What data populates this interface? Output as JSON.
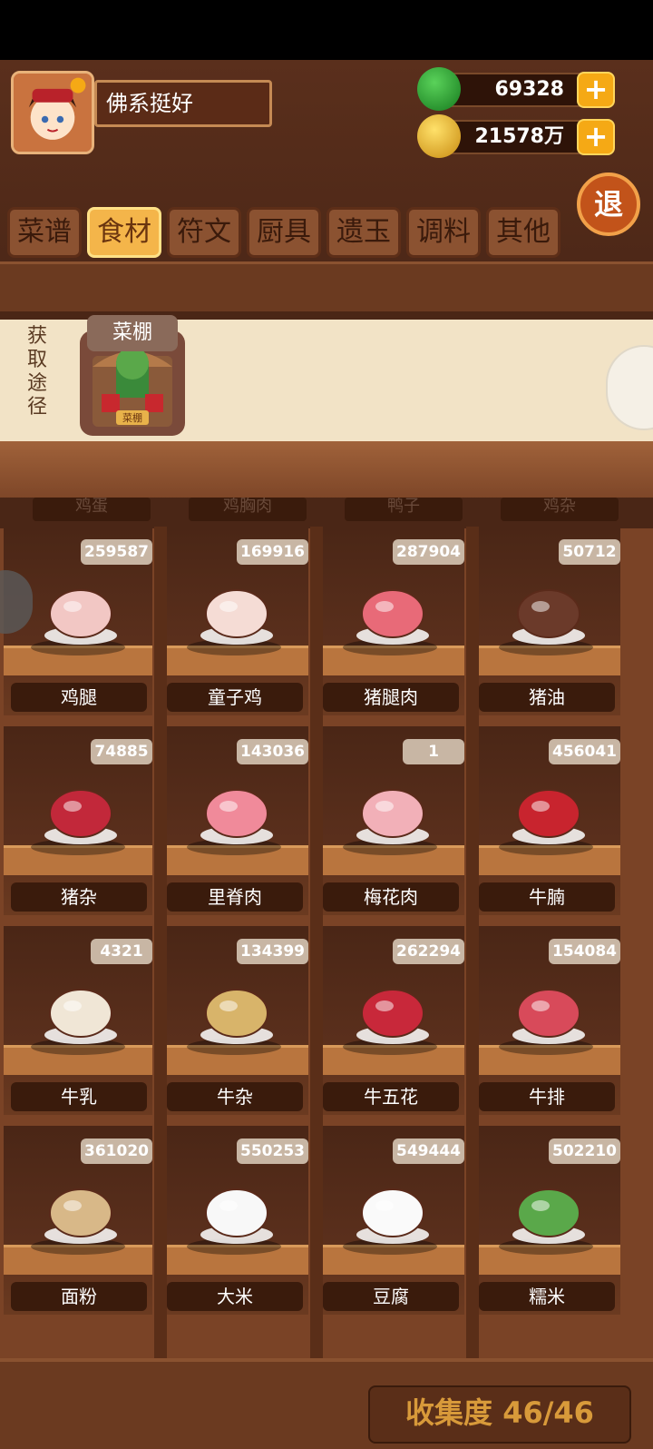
{
  "player": {
    "name": "佛系挺好"
  },
  "resources": [
    {
      "name": "jade",
      "value": "69328",
      "color": "#1f8a2a"
    },
    {
      "name": "coin",
      "value": "21578万",
      "color": "#e0a818"
    }
  ],
  "exit_label": "退",
  "tabs": [
    {
      "label": "菜谱",
      "active": false
    },
    {
      "label": "食材",
      "active": true
    },
    {
      "label": "符文",
      "active": false
    },
    {
      "label": "厨具",
      "active": false
    },
    {
      "label": "遗玉",
      "active": false
    },
    {
      "label": "调料",
      "active": false
    },
    {
      "label": "其他",
      "active": false
    }
  ],
  "source": {
    "title": "获取途径",
    "card_label": "菜棚",
    "card_sign": "菜棚"
  },
  "top_row_labels": [
    "鸡蛋",
    "鸡胸肉",
    "鸭子",
    "鸡杂"
  ],
  "items": [
    {
      "name": "鸡腿",
      "count": "259587",
      "icon": "chicken-leg-icon",
      "color": "#f2c7c4"
    },
    {
      "name": "童子鸡",
      "count": "169916",
      "icon": "whole-chicken-icon",
      "color": "#f5dcd5"
    },
    {
      "name": "猪腿肉",
      "count": "287904",
      "icon": "pork-slices-icon",
      "color": "#e86a78"
    },
    {
      "name": "猪油",
      "count": "50712",
      "icon": "lard-bowl-icon",
      "color": "#6b3a2a"
    },
    {
      "name": "猪杂",
      "count": "74885",
      "icon": "pork-offal-icon",
      "color": "#c2283a"
    },
    {
      "name": "里脊肉",
      "count": "143036",
      "icon": "tenderloin-icon",
      "color": "#f08a9a"
    },
    {
      "name": "梅花肉",
      "count": "1",
      "icon": "pork-shoulder-icon",
      "color": "#f2b0b8"
    },
    {
      "name": "牛腩",
      "count": "456041",
      "icon": "beef-brisket-icon",
      "color": "#c8242e"
    },
    {
      "name": "牛乳",
      "count": "4321",
      "icon": "milk-jar-icon",
      "color": "#f0e6d6"
    },
    {
      "name": "牛杂",
      "count": "134399",
      "icon": "beef-offal-icon",
      "color": "#d8b46a"
    },
    {
      "name": "牛五花",
      "count": "262294",
      "icon": "beef-belly-icon",
      "color": "#c8283a"
    },
    {
      "name": "牛排",
      "count": "154084",
      "icon": "steak-icon",
      "color": "#d84a5a"
    },
    {
      "name": "面粉",
      "count": "361020",
      "icon": "flour-sack-icon",
      "color": "#d8b888"
    },
    {
      "name": "大米",
      "count": "550253",
      "icon": "rice-bowl-icon",
      "color": "#f8f8f8"
    },
    {
      "name": "豆腐",
      "count": "549444",
      "icon": "tofu-icon",
      "color": "#fafafa"
    },
    {
      "name": "糯米",
      "count": "502210",
      "icon": "sticky-rice-icon",
      "color": "#5aa84a"
    }
  ],
  "collection": "收集度 46/46"
}
